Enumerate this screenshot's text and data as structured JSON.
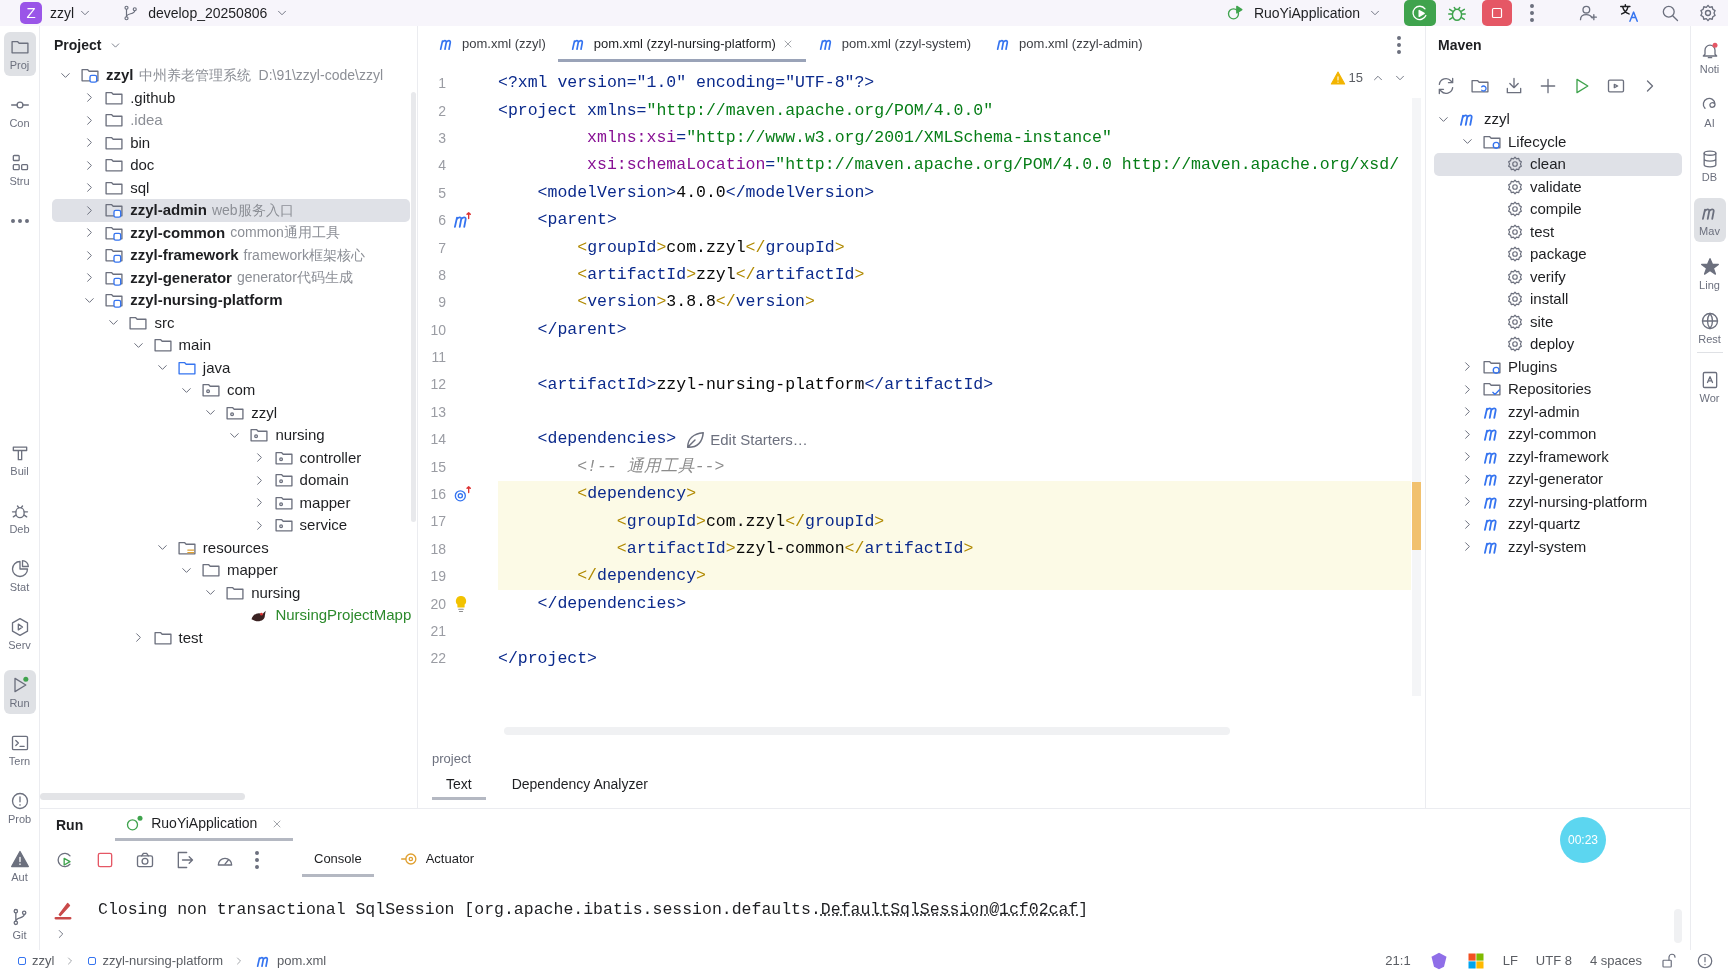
{
  "top_bar": {
    "project_badge": "Z",
    "project": "zzyl",
    "branch": "develop_20250806",
    "run_config": "RuoYiApplication"
  },
  "left_strip": {
    "top": [
      {
        "kind": "folder",
        "label": "Proj",
        "selected": true
      },
      {
        "kind": "commit",
        "label": "Con",
        "selected": false
      },
      {
        "kind": "structure",
        "label": "Stru",
        "selected": false
      },
      {
        "kind": "more",
        "selected": false
      }
    ],
    "bottom": [
      {
        "kind": "build",
        "label": "Buil",
        "selected": false
      },
      {
        "kind": "debug",
        "label": "Deb",
        "selected": false
      },
      {
        "kind": "profiler",
        "label": "Stat",
        "selected": false
      },
      {
        "kind": "services",
        "label": "Serv",
        "selected": false
      },
      {
        "kind": "run",
        "label": "Run",
        "selected": true
      },
      {
        "kind": "terminal",
        "label": "Tern",
        "selected": false
      },
      {
        "kind": "problems",
        "label": "Prob",
        "selected": false
      },
      {
        "kind": "warning",
        "label": "Aut",
        "selected": false
      },
      {
        "kind": "git",
        "label": "Git",
        "selected": false
      }
    ]
  },
  "project_panel": {
    "title": "Project",
    "tree": [
      {
        "label": "zzyl",
        "note": "中州养老管理系统",
        "path": "D:\\91\\zzyl-code\\zzyl",
        "kind": "module",
        "expanded": true,
        "selected": false,
        "children": [
          {
            "label": ".github",
            "kind": "folder",
            "expanded": false,
            "selected": false
          },
          {
            "label": ".idea",
            "kind": "ignored_folder",
            "expanded": false,
            "selected": false
          },
          {
            "label": "bin",
            "kind": "folder",
            "expanded": false,
            "selected": false
          },
          {
            "label": "doc",
            "kind": "folder",
            "expanded": false,
            "selected": false
          },
          {
            "label": "sql",
            "kind": "folder",
            "expanded": false,
            "selected": false
          },
          {
            "label": "zzyl-admin",
            "note": "web服务入口",
            "kind": "module",
            "expanded": false,
            "selected": true
          },
          {
            "label": "zzyl-common",
            "note": "common通用工具",
            "kind": "module",
            "expanded": false,
            "selected": false
          },
          {
            "label": "zzyl-framework",
            "note": "framework框架核心",
            "kind": "module",
            "expanded": false,
            "selected": false
          },
          {
            "label": "zzyl-generator",
            "note": "generator代码生成",
            "kind": "module",
            "expanded": false,
            "selected": false
          },
          {
            "label": "zzyl-nursing-platform",
            "kind": "module",
            "expanded": true,
            "selected": false,
            "children": [
              {
                "label": "src",
                "kind": "folder",
                "expanded": true,
                "selected": false,
                "children": [
                  {
                    "label": "main",
                    "kind": "folder",
                    "expanded": true,
                    "selected": false,
                    "children": [
                      {
                        "label": "java",
                        "kind": "source_folder",
                        "expanded": true,
                        "selected": false,
                        "children": [
                          {
                            "label": "com",
                            "kind": "package",
                            "expanded": true,
                            "selected": false,
                            "children": [
                              {
                                "label": "zzyl",
                                "kind": "package",
                                "expanded": true,
                                "selected": false,
                                "children": [
                                  {
                                    "label": "nursing",
                                    "kind": "package",
                                    "expanded": true,
                                    "selected": false,
                                    "children": [
                                      {
                                        "label": "controller",
                                        "kind": "package",
                                        "expanded": false,
                                        "selected": false
                                      },
                                      {
                                        "label": "domain",
                                        "kind": "package",
                                        "expanded": false,
                                        "selected": false
                                      },
                                      {
                                        "label": "mapper",
                                        "kind": "package",
                                        "expanded": false,
                                        "selected": false
                                      },
                                      {
                                        "label": "service",
                                        "kind": "package",
                                        "expanded": false,
                                        "selected": false
                                      }
                                    ]
                                  }
                                ]
                              }
                            ]
                          }
                        ]
                      },
                      {
                        "label": "resources",
                        "kind": "resources",
                        "expanded": true,
                        "selected": false,
                        "children": [
                          {
                            "label": "mapper",
                            "kind": "folder",
                            "expanded": true,
                            "selected": false,
                            "children": [
                              {
                                "label": "nursing",
                                "kind": "folder",
                                "expanded": true,
                                "selected": false,
                                "children": [
                                  {
                                    "label": "NursingProjectMapp",
                                    "kind": "mybatis_file",
                                    "selected": false
                                  }
                                ]
                              }
                            ]
                          }
                        ]
                      }
                    ]
                  },
                  {
                    "label": "test",
                    "kind": "folder",
                    "expanded": false,
                    "selected": false
                  }
                ]
              }
            ]
          }
        ]
      }
    ]
  },
  "editor": {
    "tabs": [
      {
        "label": "pom.xml (zzyl)",
        "selected": false
      },
      {
        "label": "pom.xml (zzyl-nursing-platform)",
        "selected": true
      },
      {
        "label": "pom.xml (zzyl-system)",
        "selected": false
      },
      {
        "label": "pom.xml (zzyl-admin)",
        "selected": false
      }
    ],
    "warnings": "15",
    "lines": [
      {
        "number": "1",
        "highlighted": false,
        "code": [
          {
            "t": "<?xml version=\"1.0\" encoding=\"UTF-8\"?>",
            "kind": "tag"
          }
        ]
      },
      {
        "number": "2",
        "highlighted": false,
        "code": [
          {
            "t": "<project xmlns=",
            "kind": "tag"
          },
          {
            "t": "\"http://maven.apache.org/POM/4.0.0\"",
            "kind": "value"
          }
        ]
      },
      {
        "number": "3",
        "highlighted": false,
        "code": [
          {
            "t": "         xmlns:xsi",
            "kind": "attr"
          },
          {
            "t": "=",
            "kind": "tag"
          },
          {
            "t": "\"http://www.w3.org/2001/XMLSchema-instance\"",
            "kind": "value"
          }
        ]
      },
      {
        "number": "4",
        "highlighted": false,
        "code": [
          {
            "t": "         xsi:schemaLocation",
            "kind": "attr"
          },
          {
            "t": "=",
            "kind": "tag"
          },
          {
            "t": "\"http://maven.apache.org/POM/4.0.0 http://maven.apache.org/xsd/",
            "kind": "value"
          }
        ]
      },
      {
        "number": "5",
        "highlighted": false,
        "code": [
          {
            "t": "    <modelVersion>",
            "kind": "tag"
          },
          {
            "t": "4.0.0",
            "kind": "text"
          },
          {
            "t": "</modelVersion>",
            "kind": "tag"
          }
        ]
      },
      {
        "number": "6",
        "highlighted": false,
        "gutter_icon": {
          "kind": "maven_parent"
        },
        "code": [
          {
            "t": "    <parent>",
            "kind": "tag"
          }
        ]
      },
      {
        "number": "7",
        "highlighted": false,
        "code": [
          {
            "t": "        <",
            "kind": "brace"
          },
          {
            "t": "groupId",
            "kind": "tag"
          },
          {
            "t": ">",
            "kind": "brace"
          },
          {
            "t": "com.zzyl",
            "kind": "text"
          },
          {
            "t": "</",
            "kind": "brace"
          },
          {
            "t": "groupId",
            "kind": "tag"
          },
          {
            "t": ">",
            "kind": "brace"
          }
        ]
      },
      {
        "number": "8",
        "highlighted": false,
        "code": [
          {
            "t": "        <",
            "kind": "brace"
          },
          {
            "t": "artifactId",
            "kind": "tag"
          },
          {
            "t": ">",
            "kind": "brace"
          },
          {
            "t": "zzyl",
            "kind": "text"
          },
          {
            "t": "</",
            "kind": "brace"
          },
          {
            "t": "artifactId",
            "kind": "tag"
          },
          {
            "t": ">",
            "kind": "brace"
          }
        ]
      },
      {
        "number": "9",
        "highlighted": false,
        "code": [
          {
            "t": "        <",
            "kind": "brace"
          },
          {
            "t": "version",
            "kind": "tag"
          },
          {
            "t": ">",
            "kind": "brace"
          },
          {
            "t": "3.8.8",
            "kind": "text"
          },
          {
            "t": "</",
            "kind": "brace"
          },
          {
            "t": "version",
            "kind": "tag"
          },
          {
            "t": ">",
            "kind": "brace"
          }
        ]
      },
      {
        "number": "10",
        "highlighted": false,
        "code": [
          {
            "t": "    </parent>",
            "kind": "tag"
          }
        ]
      },
      {
        "number": "11",
        "highlighted": false
      },
      {
        "number": "12",
        "highlighted": false,
        "code": [
          {
            "t": "    <artifactId>",
            "kind": "tag"
          },
          {
            "t": "zzyl-nursing-platform",
            "kind": "text"
          },
          {
            "t": "</artifactId>",
            "kind": "tag"
          }
        ]
      },
      {
        "number": "13",
        "highlighted": false
      },
      {
        "number": "14",
        "highlighted": false,
        "code": [
          {
            "t": "    <dependencies>",
            "kind": "tag"
          }
        ],
        "hint": "Edit Starters…"
      },
      {
        "number": "15",
        "highlighted": false,
        "code": [
          {
            "t": "        <!-- 通用工具-->",
            "kind": "comment"
          }
        ]
      },
      {
        "number": "16",
        "highlighted": true,
        "gutter_icon": {
          "kind": "dependency"
        },
        "code": [
          {
            "t": "        <",
            "kind": "brace"
          },
          {
            "t": "dependency",
            "kind": "tag"
          },
          {
            "t": ">",
            "kind": "brace"
          }
        ]
      },
      {
        "number": "17",
        "highlighted": true,
        "code": [
          {
            "t": "            <",
            "kind": "brace"
          },
          {
            "t": "groupId",
            "kind": "tag"
          },
          {
            "t": ">",
            "kind": "brace"
          },
          {
            "t": "com.zzyl",
            "kind": "text"
          },
          {
            "t": "</",
            "kind": "brace"
          },
          {
            "t": "groupId",
            "kind": "tag"
          },
          {
            "t": ">",
            "kind": "brace"
          }
        ]
      },
      {
        "number": "18",
        "highlighted": true,
        "code": [
          {
            "t": "            <",
            "kind": "brace"
          },
          {
            "t": "artifactId",
            "kind": "tag"
          },
          {
            "t": ">",
            "kind": "brace"
          },
          {
            "t": "zzyl-common",
            "kind": "text"
          },
          {
            "t": "</",
            "kind": "brace"
          },
          {
            "t": "artifactId",
            "kind": "tag"
          },
          {
            "t": ">",
            "kind": "brace"
          }
        ]
      },
      {
        "number": "19",
        "highlighted": true,
        "code": [
          {
            "t": "        </",
            "kind": "brace"
          },
          {
            "t": "dependency",
            "kind": "tag"
          },
          {
            "t": ">",
            "kind": "brace"
          }
        ]
      },
      {
        "number": "20",
        "highlighted": false,
        "gutter_icon": {
          "kind": "bulb"
        },
        "code": [
          {
            "t": "    </dependencies>",
            "kind": "tag"
          }
        ]
      },
      {
        "number": "21",
        "highlighted": false
      },
      {
        "number": "22",
        "highlighted": false,
        "code": [
          {
            "t": "</project>",
            "kind": "tag"
          }
        ]
      }
    ],
    "breadcrumb": "project",
    "bottom_tabs": [
      {
        "label": "Text",
        "selected": true
      },
      {
        "label": "Dependency Analyzer",
        "selected": false
      }
    ]
  },
  "maven": {
    "title": "Maven",
    "tree": [
      {
        "label": "zzyl",
        "kind": "project",
        "expanded": true,
        "selected": false,
        "children": [
          {
            "label": "Lifecycle",
            "kind": "lifecycle",
            "expanded": true,
            "selected": false,
            "children": [
              {
                "label": "clean",
                "kind": "goal",
                "selected": true
              },
              {
                "label": "validate",
                "kind": "goal",
                "selected": false
              },
              {
                "label": "compile",
                "kind": "goal",
                "selected": false
              },
              {
                "label": "test",
                "kind": "goal",
                "selected": false
              },
              {
                "label": "package",
                "kind": "goal",
                "selected": false
              },
              {
                "label": "verify",
                "kind": "goal",
                "selected": false
              },
              {
                "label": "install",
                "kind": "goal",
                "selected": false
              },
              {
                "label": "site",
                "kind": "goal",
                "selected": false
              },
              {
                "label": "deploy",
                "kind": "goal",
                "selected": false
              }
            ]
          },
          {
            "label": "Plugins",
            "kind": "lifecycle",
            "expanded": false,
            "selected": false
          },
          {
            "label": "Repositories",
            "kind": "repositories",
            "expanded": false,
            "selected": false
          },
          {
            "label": "zzyl-admin",
            "kind": "project",
            "expanded": false,
            "selected": false
          },
          {
            "label": "zzyl-common",
            "kind": "project",
            "expanded": false,
            "selected": false
          },
          {
            "label": "zzyl-framework",
            "kind": "project",
            "expanded": false,
            "selected": false
          },
          {
            "label": "zzyl-generator",
            "kind": "project",
            "expanded": false,
            "selected": false
          },
          {
            "label": "zzyl-nursing-platform",
            "kind": "project",
            "expanded": false,
            "selected": false
          },
          {
            "label": "zzyl-quartz",
            "kind": "project",
            "expanded": false,
            "selected": false
          },
          {
            "label": "zzyl-system",
            "kind": "project",
            "expanded": false,
            "selected": false
          }
        ]
      }
    ]
  },
  "right_strip": [
    {
      "kind": "bell",
      "label": "Noti",
      "selected": false
    },
    {
      "kind": "ai",
      "label": "AI",
      "selected": false
    },
    {
      "kind": "database",
      "label": "DB",
      "selected": false
    },
    {
      "kind": "maven",
      "label": "Mav",
      "selected": true
    },
    {
      "kind": "star",
      "label": "Ling",
      "selected": false
    },
    {
      "kind": "globe",
      "label": "Rest",
      "selected": false
    },
    {
      "kind": "book",
      "label": "Wor",
      "selected": false
    }
  ],
  "run_panel": {
    "title": "Run",
    "tab": "RuoYiApplication",
    "console_tabs": [
      {
        "label": "Console",
        "selected": true
      },
      {
        "label": "Actuator",
        "selected": false
      }
    ],
    "console_line": {
      "text": "Closing non transactional SqlSession [org.apache.ibatis.session.defaults.",
      "link": "DefaultSqlSession@1cf02caf",
      "after": "]"
    },
    "timer": "00:23"
  },
  "status_bar": {
    "breadcrumbs": [
      {
        "label": "zzyl",
        "kind": "module"
      },
      {
        "label": "zzyl-nursing-platform",
        "kind": "module"
      },
      {
        "label": "pom.xml",
        "kind": "maven"
      }
    ],
    "position": "21:1",
    "line_ending": "LF",
    "encoding": "UTF 8",
    "indent": "4 spaces"
  }
}
